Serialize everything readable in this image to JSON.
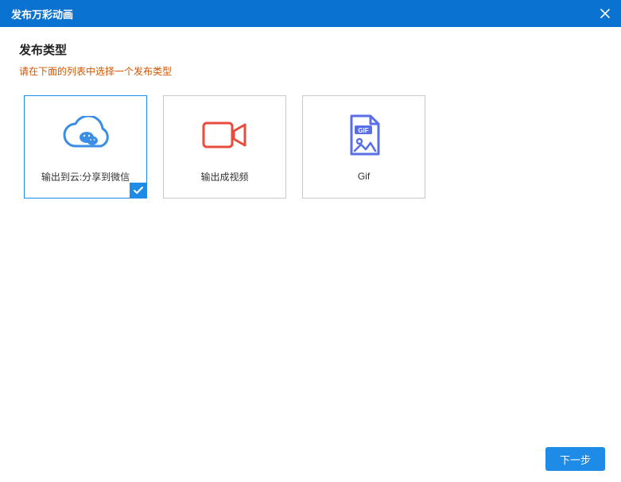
{
  "titlebar": {
    "title": "发布万彩动画"
  },
  "section": {
    "title": "发布类型",
    "hint": "请在下面的列表中选择一个发布类型"
  },
  "cards": [
    {
      "label": "输出到云:分享到微信",
      "icon": "cloud-wechat",
      "selected": true
    },
    {
      "label": "输出成视频",
      "icon": "video",
      "selected": false
    },
    {
      "label": "Gif",
      "icon": "gif",
      "selected": false
    }
  ],
  "footer": {
    "next": "下一步"
  },
  "colors": {
    "primary": "#1e8be6",
    "titlebar": "#0a72d0",
    "hint": "#d35400",
    "iconBlue": "#3a8ee6",
    "iconRed": "#e74c3c",
    "iconIndigo": "#5a6ee6"
  }
}
